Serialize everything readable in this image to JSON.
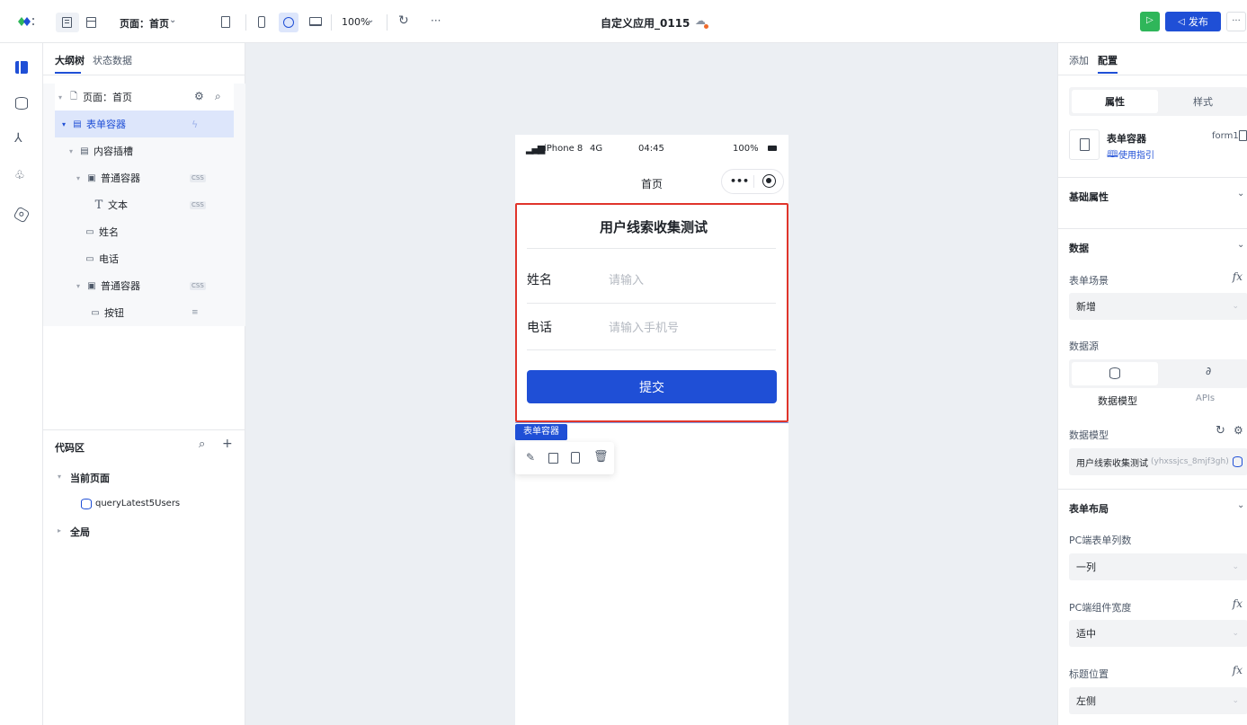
{
  "topbar": {
    "page_select": "页面：首页",
    "zoom": "100%",
    "app_title": "自定义应用_0115",
    "publish_label": "发布",
    "more": "···"
  },
  "left_panel": {
    "tabs": [
      "大纲树",
      "状态数据"
    ],
    "tree": [
      {
        "label": "页面：首页",
        "icon": "page-icon",
        "caret": true
      },
      {
        "label": "表单容器",
        "icon": "form-icon",
        "caret": true,
        "selected": true
      },
      {
        "label": "内容插槽",
        "icon": "slot-icon",
        "caret": true
      },
      {
        "label": "普通容器",
        "icon": "container-icon",
        "caret": true,
        "badge": "CSS"
      },
      {
        "label": "文本",
        "icon": "text-icon",
        "caret": false,
        "badge": "CSS"
      },
      {
        "label": "姓名",
        "icon": "input-icon",
        "caret": false
      },
      {
        "label": "电话",
        "icon": "phone-input-icon",
        "caret": false
      },
      {
        "label": "普通容器",
        "icon": "container-icon",
        "caret": true,
        "badge": "CSS"
      },
      {
        "label": "按钮",
        "icon": "button-icon",
        "caret": false
      }
    ],
    "code_area": {
      "title": "代码区",
      "current_page": "当前页面",
      "query": "queryLatest5Users",
      "global": "全局"
    }
  },
  "phone": {
    "status_left": "iPhone 8",
    "network": "4G",
    "time": "04:45",
    "battery": "100%",
    "nav_title": "首页",
    "form": {
      "title": "用户线索收集测试",
      "fields": [
        {
          "label": "姓名",
          "placeholder": "请输入"
        },
        {
          "label": "电话",
          "placeholder": "请输入手机号"
        }
      ],
      "submit": "提交",
      "tag": "表单容器"
    }
  },
  "right_panel": {
    "tabs": [
      "添加",
      "配置"
    ],
    "segment": [
      "属性",
      "样式"
    ],
    "component_name": "表单容器",
    "component_id": "form1",
    "guide_link": "使用指引",
    "basic_props": "基础属性",
    "data_section": "数据",
    "form_scene_label": "表单场景",
    "form_scene_value": "新增",
    "datasource_label": "数据源",
    "datasource_options": [
      "数据模型",
      "APIs"
    ],
    "data_model_label": "数据模型",
    "data_model_name": "用户线索收集测试",
    "data_model_id": "(yhxssjcs_8mjf3gh)",
    "layout_section": "表单布局",
    "pc_cols_label": "PC端表单列数",
    "pc_cols_value": "一列",
    "pc_width_label": "PC端组件宽度",
    "pc_width_value": "适中",
    "title_pos_label": "标题位置",
    "title_pos_value": "左侧",
    "fx": "fx"
  },
  "colors": {
    "accent": "#1f4fd6",
    "green": "#2fb65a",
    "highlight": "#e0352b"
  }
}
